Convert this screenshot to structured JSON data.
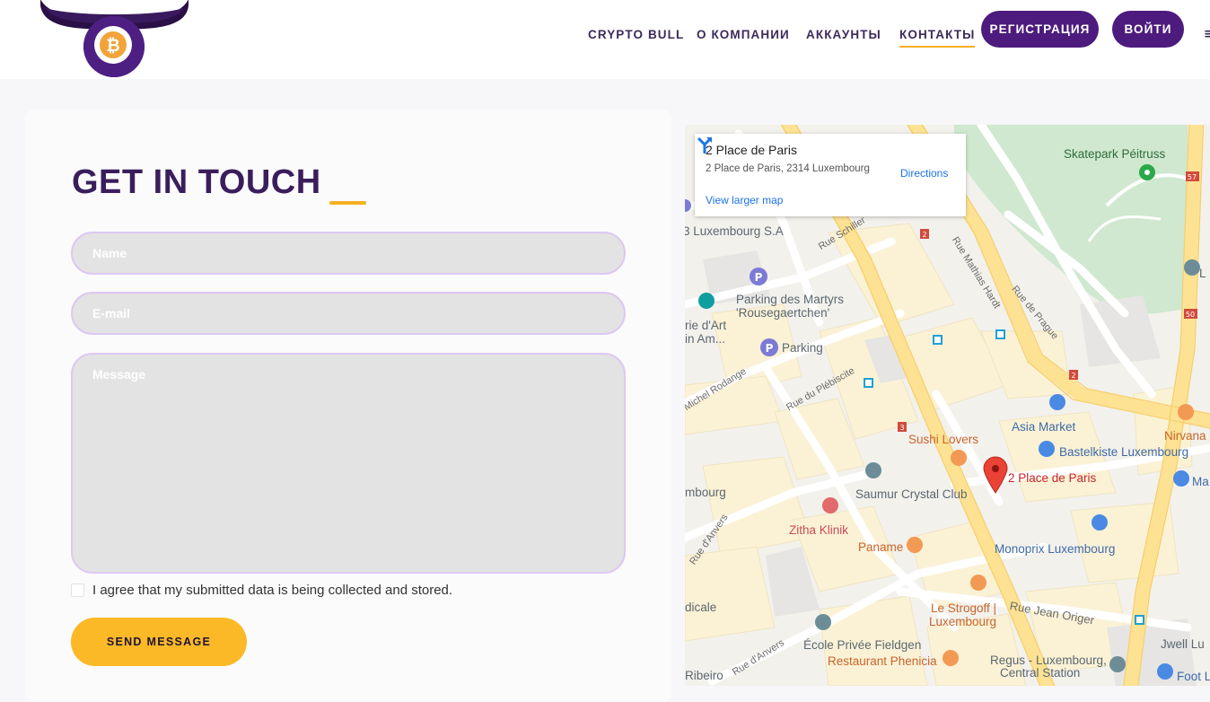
{
  "nav": {
    "items": [
      "CRYPTO BULL",
      "О КОМПАНИИ",
      "АККАУНТЫ",
      "КОНТАКТЫ"
    ],
    "active": "КОНТАКТЫ",
    "register": "РЕГИСТРАЦИЯ",
    "login": "ВОЙТИ"
  },
  "colors": {
    "brand_purple": "#4d1b7d",
    "accent_yellow": "#fcb927",
    "title": "#3a1e5c"
  },
  "contact": {
    "title": "GET IN TOUCH",
    "name_placeholder": "Name",
    "email_placeholder": "E-mail",
    "message_placeholder": "Message",
    "agree_text": "I agree that my submitted data is being collected and stored.",
    "agree_checked": false,
    "send_label": "SEND MESSAGE"
  },
  "map": {
    "info": {
      "title": "2 Place de Paris",
      "address": "2 Place de Paris, 2314 Luxembourg",
      "directions": "Directions",
      "larger_map": "View larger map"
    },
    "places": {
      "skatepark": "Skatepark Péitruss",
      "luxembourg_sa": "3 Luxembourg S.A",
      "parking_martyrs_1": "Parking des Martyrs",
      "parking_martyrs_2": "'Rousegaertchen'",
      "musee_1": "rie d'Art",
      "musee_2": "in Am...",
      "parking": "Parking",
      "asia_market": "Asia Market",
      "nirvana": "Nirvana",
      "sushi_lovers": "Sushi Lovers",
      "bastelkiste": "Bastelkiste Luxembourg",
      "marker": "2 Place de Paris",
      "ma": "Ma",
      "saumur": "Saumur Crystal Club",
      "luxembourg_left": "mbourg",
      "zitha": "Zitha Klinik",
      "paname": "Paname",
      "monoprix": "Monoprix Luxembourg",
      "dicale": "dicale",
      "strogoff_1": "Le Strogoff |",
      "strogoff_2": "Luxembourg",
      "jwell": "Jwell Lu",
      "ecole": "École Privée Fieldgen",
      "phenicia": "Restaurant Phenicia",
      "regus_1": "Regus - Luxembourg,",
      "regus_2": "Central Station",
      "footl": "Foot L",
      "ribeiro": "Ribeiro",
      "L": "L"
    },
    "streets": {
      "schiller": "Rue Schiller",
      "hardt": "Rue Mathias Hardt",
      "prague": "Rue de Prague",
      "plebiscite": "Rue du Plébiscite",
      "rodange": "Michel Rodange",
      "anvers1": "Rue d'Anvers",
      "anvers2": "Rue d'Anvers",
      "origer": "Rue Jean Origer"
    },
    "road_numbers": [
      "2",
      "2",
      "3",
      "57",
      "50"
    ]
  }
}
